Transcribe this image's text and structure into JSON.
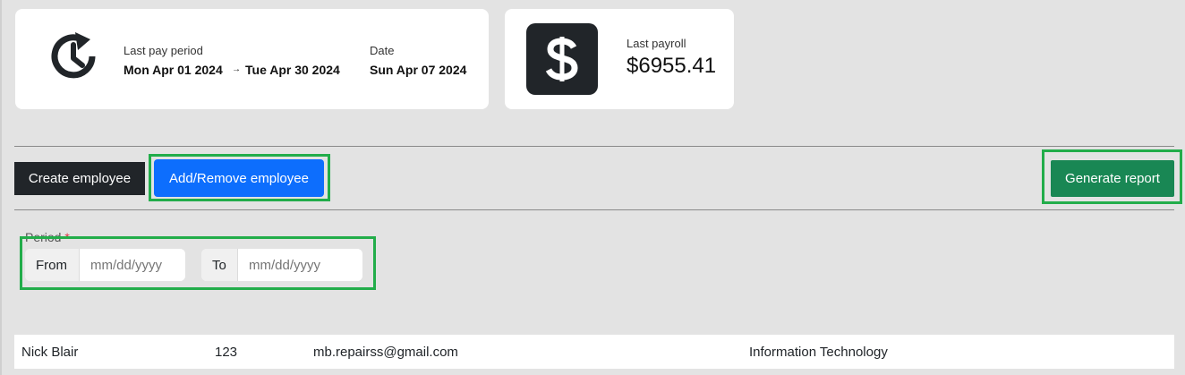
{
  "period_card": {
    "last_pay_period_label": "Last pay period",
    "start_date": "Mon Apr 01 2024",
    "arrow": "→",
    "end_date": "Tue Apr 30 2024",
    "date_label": "Date",
    "date_value": "Sun Apr 07 2024"
  },
  "payroll_card": {
    "label": "Last payroll",
    "amount": "$6955.41"
  },
  "toolbar": {
    "create_label": "Create employee",
    "add_remove_label": "Add/Remove employee",
    "generate_label": "Generate report"
  },
  "period_filter": {
    "label": "Period",
    "required_mark": "*",
    "from_label": "From",
    "from_placeholder": "mm/dd/yyyy",
    "to_label": "To",
    "to_placeholder": "mm/dd/yyyy"
  },
  "employees": [
    {
      "name": "Nick Blair",
      "id": "123",
      "email": "mb.repairss@gmail.com",
      "department": "Information Technology"
    }
  ],
  "colors": {
    "primary": "#0d6efd",
    "success": "#198754",
    "dark": "#212529",
    "highlight": "#22ad4a"
  },
  "icons": [
    "clock-refresh-icon",
    "dollar-icon",
    "arrow-right-icon"
  ]
}
